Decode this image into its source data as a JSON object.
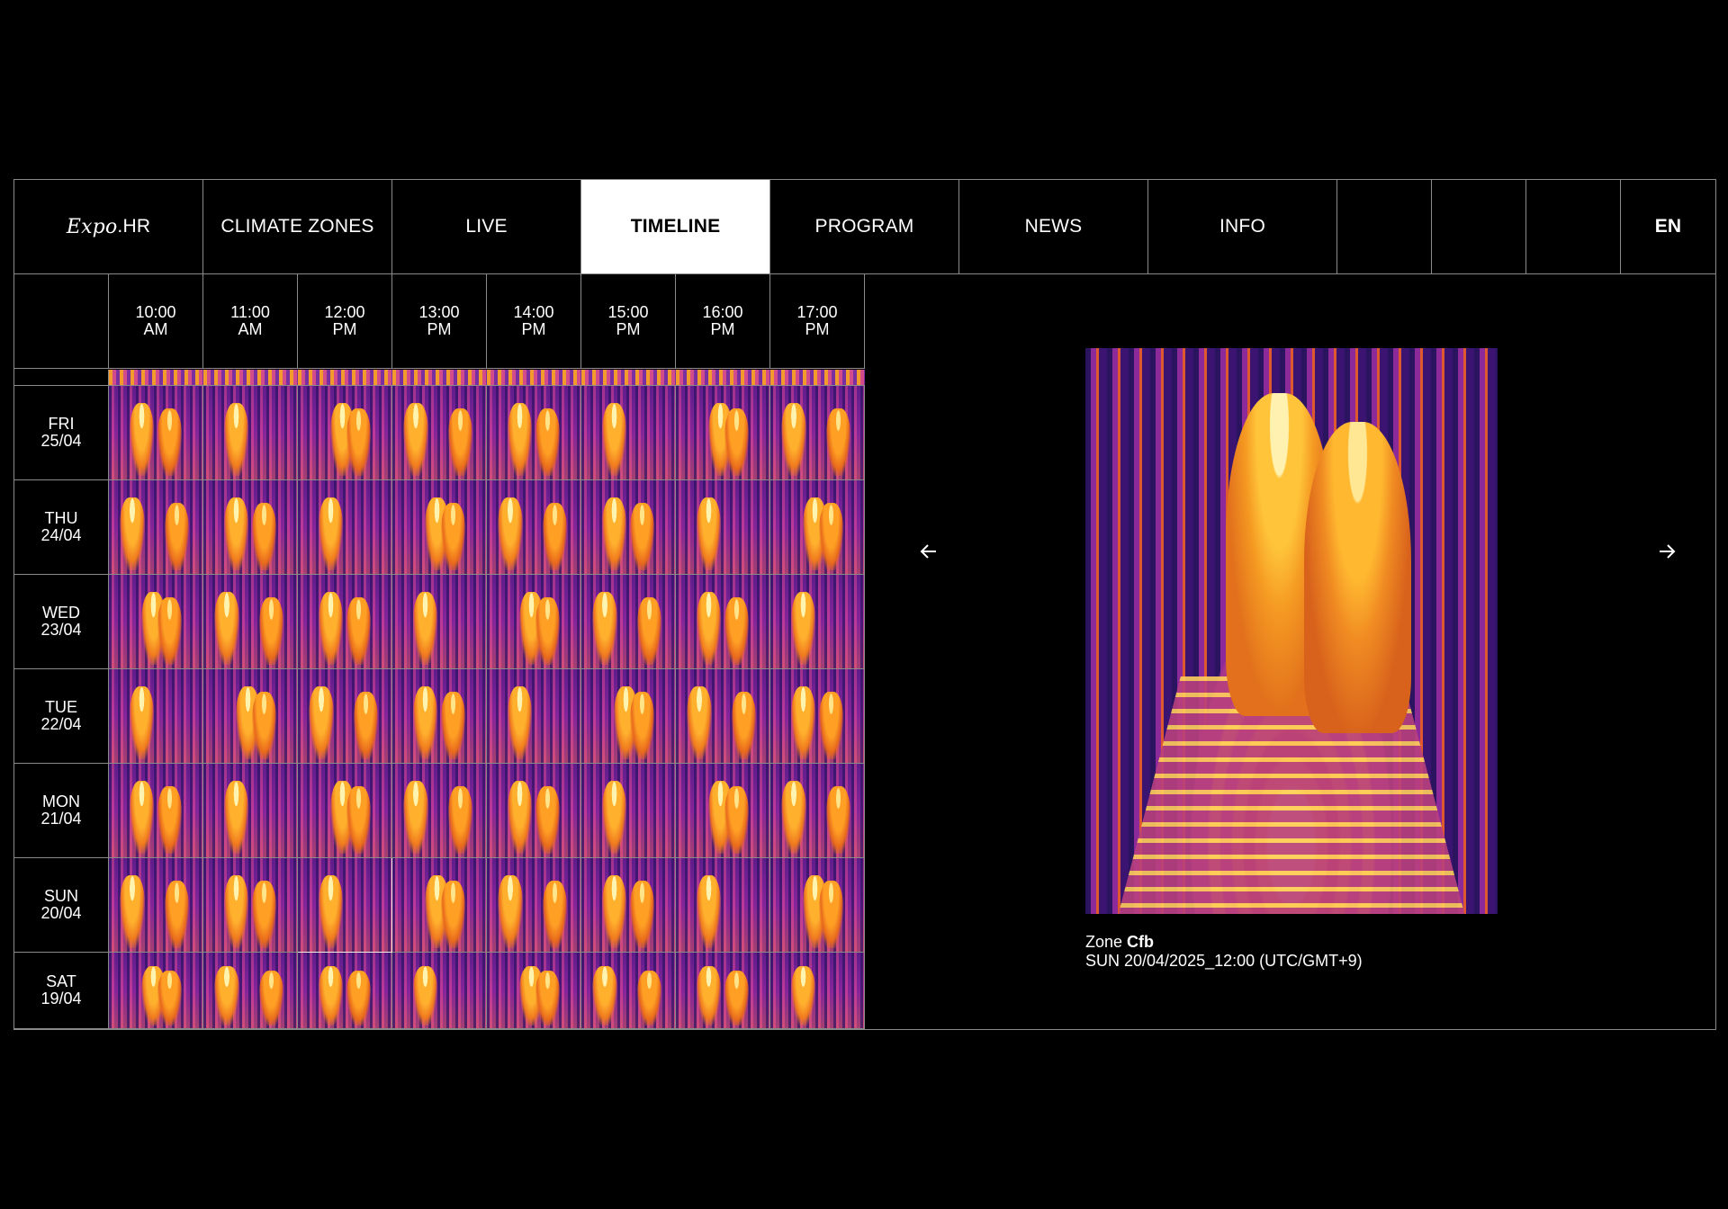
{
  "nav": {
    "logo_italic": "Expo",
    "logo_rest": ".HR",
    "items": [
      "CLIMATE ZONES",
      "LIVE",
      "TIMELINE",
      "PROGRAM",
      "NEWS",
      "INFO"
    ],
    "active": "TIMELINE",
    "language": "EN"
  },
  "timeline": {
    "times": [
      {
        "time": "10:00",
        "period": "AM"
      },
      {
        "time": "11:00",
        "period": "AM"
      },
      {
        "time": "12:00",
        "period": "PM"
      },
      {
        "time": "13:00",
        "period": "PM"
      },
      {
        "time": "14:00",
        "period": "PM"
      },
      {
        "time": "15:00",
        "period": "PM"
      },
      {
        "time": "16:00",
        "period": "PM"
      },
      {
        "time": "17:00",
        "period": "PM"
      }
    ],
    "days": [
      {
        "day": "FRI",
        "date": "25/04"
      },
      {
        "day": "THU",
        "date": "24/04"
      },
      {
        "day": "WED",
        "date": "23/04"
      },
      {
        "day": "TUE",
        "date": "22/04"
      },
      {
        "day": "MON",
        "date": "21/04"
      },
      {
        "day": "SUN",
        "date": "20/04"
      },
      {
        "day": "SAT",
        "date": "19/04"
      }
    ],
    "selected": {
      "day_index": 5,
      "time_index": 2
    }
  },
  "viewer": {
    "prev_icon": "arrow-left-icon",
    "next_icon": "arrow-right-icon",
    "zone_label": "Zone",
    "zone_code": "Cfb",
    "timestamp": "SUN 20/04/2025_12:00 (UTC/GMT+9)"
  }
}
